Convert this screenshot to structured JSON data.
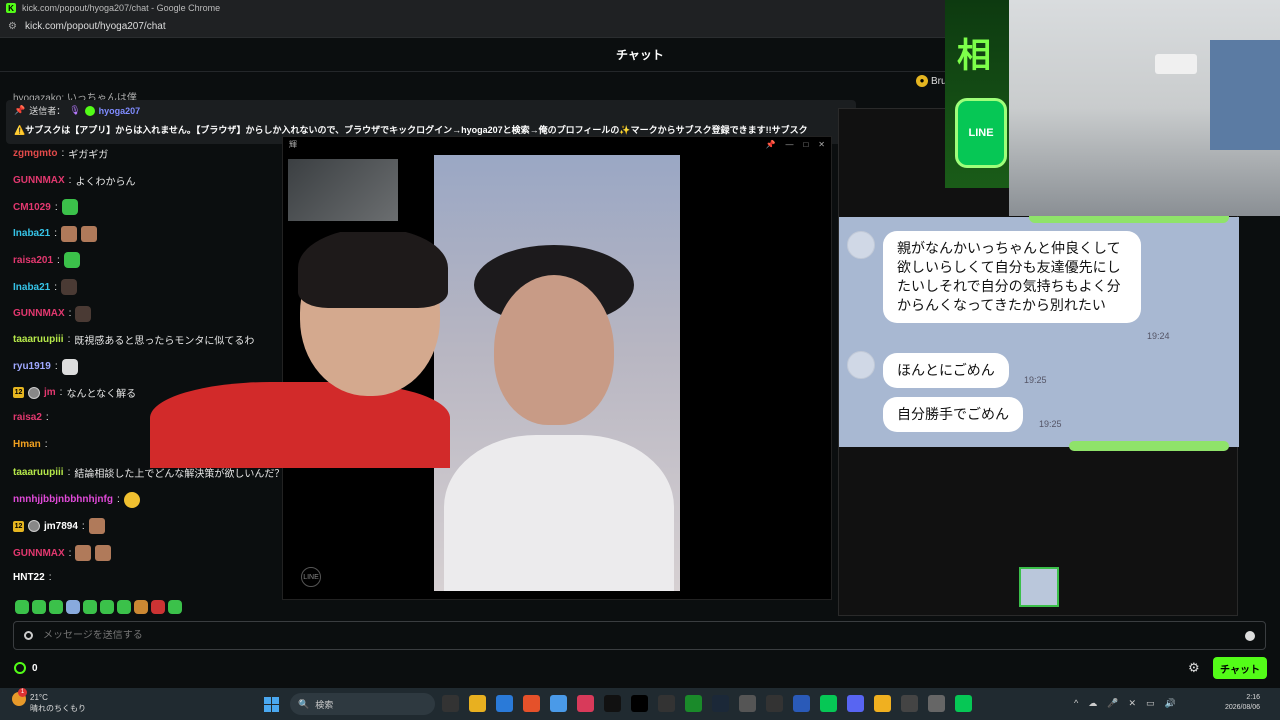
{
  "browser": {
    "window_title": "kick.com/popout/hyoga207/chat - Google Chrome",
    "url": "kick.com/popout/hyoga207/chat",
    "favicon": "K"
  },
  "header": {
    "title": "チャット"
  },
  "partial_top_message": "hyogazako: いっちゃんは僕",
  "pinned": {
    "label": "送信者：",
    "user": "hyoga207",
    "text": "⚠️サブスクは【アプリ】からは入れません。【ブラウザ】からしか入れないので、ブラウザでキックログイン→hyoga207と検索→俺のプロフィールの✨マークからサブスク登録できます!!サブスク"
  },
  "top_right_badge": {
    "text": "Bru"
  },
  "messages": [
    {
      "user": "zgmgmto",
      "color": "#e24a4a",
      "text": "ギガギガ"
    },
    {
      "user": "GUNNMAX",
      "color": "#e2386f",
      "text": "よくわからん"
    },
    {
      "user": "CM1029",
      "color": "#e2386f",
      "text": "",
      "emotes": [
        "green"
      ]
    },
    {
      "user": "Inaba21",
      "color": "#36c4e8",
      "text": "",
      "emotes": [
        "face",
        "face"
      ]
    },
    {
      "user": "raisa201",
      "color": "#e2386f",
      "text": "",
      "emotes": [
        "green"
      ]
    },
    {
      "user": "Inaba21",
      "color": "#36c4e8",
      "text": "",
      "emotes": [
        "dark"
      ]
    },
    {
      "user": "GUNNMAX",
      "color": "#e2386f",
      "text": "",
      "emotes": [
        "dark"
      ]
    },
    {
      "user": "taaaruupiii",
      "color": "#b6e84a",
      "text": "既視感あると思ったらモンタに似てるわ"
    },
    {
      "user": "ryu1919",
      "color": "#a0a8ff",
      "text": "",
      "emotes": [
        "white"
      ]
    },
    {
      "user": "jm",
      "color": "#e2386f",
      "text": "なんとなく解る",
      "badges": [
        "12",
        "circ"
      ]
    },
    {
      "user": "raisa2",
      "color": "#e2386f",
      "text": ""
    },
    {
      "user": "Hman",
      "color": "#f0a020",
      "text": ""
    },
    {
      "user": "taaaruupiii",
      "color": "#b6e84a",
      "text": "結論相談した上でどんな解決策が欲しいんだ？"
    },
    {
      "user": "nnnhjjbbjnbbhnhjnfg",
      "color": "#e04ad8",
      "text": "",
      "emotes": [
        "yellow"
      ]
    },
    {
      "user": "jm7894",
      "color": "#ffffff",
      "text": "",
      "badges": [
        "12",
        "circ"
      ],
      "emotes": [
        "face"
      ]
    },
    {
      "user": "GUNNMAX",
      "color": "#e2386f",
      "text": "",
      "emotes": [
        "face",
        "face"
      ]
    },
    {
      "user": "HNT22",
      "color": "#ffffff",
      "text": ""
    }
  ],
  "video_popup": {
    "title": "輝",
    "line_logo": "LINE"
  },
  "line_chat": {
    "bubbles": [
      {
        "text": "親がなんかいっちゃんと仲良くして欲しいらしくて自分も友達優先にしたいしそれで自分の気持ちもよく分からんくなってきたから別れたい",
        "time": "19:24"
      },
      {
        "text": "ほんとにごめん",
        "time": "19:25"
      },
      {
        "text": "自分勝手でごめん",
        "time": "19:25"
      }
    ]
  },
  "overlay_banner": {
    "kanji": "相",
    "app_label": "LINE"
  },
  "input": {
    "placeholder": "メッセージを送信する"
  },
  "footer": {
    "points": "0",
    "chat_button": "チャット"
  },
  "taskbar": {
    "weather_temp": "21°C",
    "weather_desc": "晴れのちくもり",
    "notification_count": "1",
    "search_placeholder": "検索",
    "time": "2:16",
    "date": "2026/08/06"
  },
  "colors": {
    "kick_green": "#53fc18",
    "line_green": "#06c755"
  }
}
